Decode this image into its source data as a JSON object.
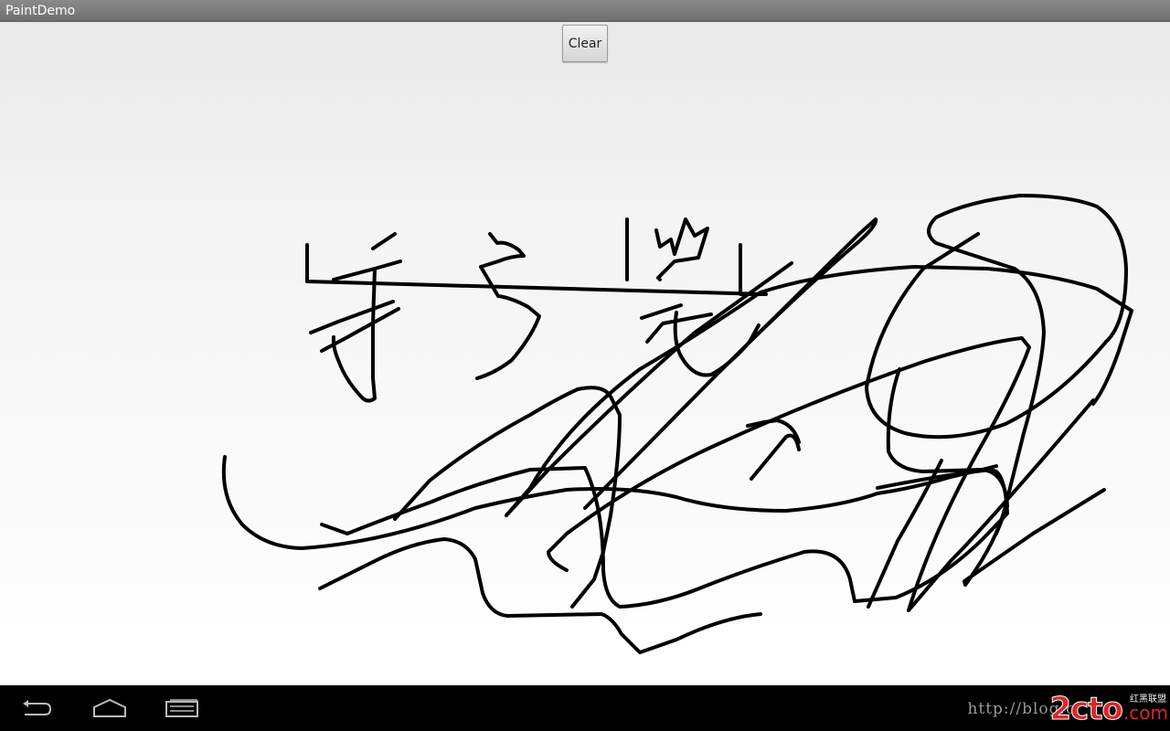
{
  "app": {
    "title": "PaintDemo"
  },
  "toolbar": {
    "clear_label": "Clear"
  },
  "navbar": {
    "back_icon": "back-icon",
    "home_icon": "home-icon",
    "recent_icon": "recent-apps-icon"
  },
  "watermark": {
    "url_text": "http://blog.c",
    "logo_text": "2cto",
    "com_text": ".com",
    "cn_text": "红黑联盟"
  },
  "colors": {
    "titlebar": "#7d7d7d",
    "stroke": "#000000",
    "navbar": "#000000",
    "watermark_red": "#d9262c"
  }
}
